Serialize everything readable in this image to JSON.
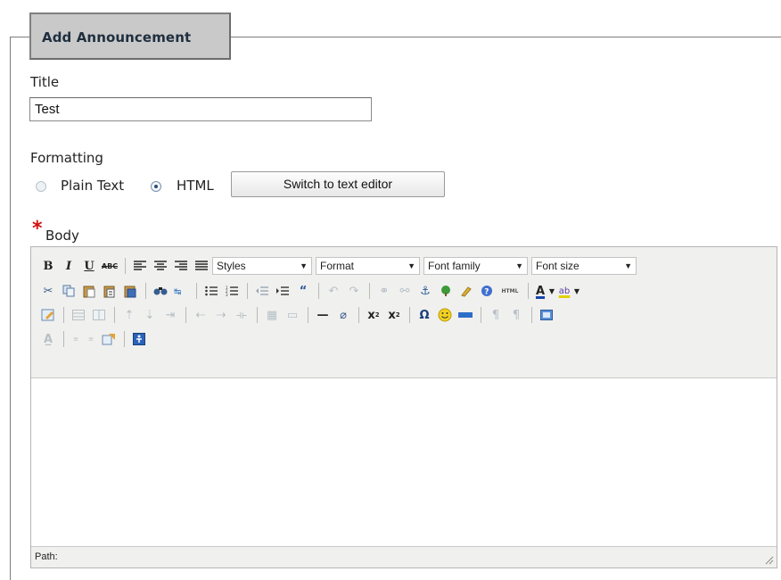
{
  "panel": {
    "legend": "Add Announcement"
  },
  "form": {
    "title_label": "Title",
    "title_value": "Test",
    "formatting_label": "Formatting",
    "radio_plain": "Plain Text",
    "radio_html": "HTML",
    "selected_format": "HTML",
    "switch_button": "Switch to text editor",
    "body_required_mark": "*",
    "body_label": "Body"
  },
  "editor": {
    "toolbar_row1": {
      "bold": "B",
      "italic": "I",
      "underline": "U",
      "strike": "ABC",
      "styles": "Styles",
      "format": "Format",
      "font_family": "Font family",
      "font_size": "Font size"
    },
    "toolbar_icons_row2": [
      "cut-icon",
      "copy-icon",
      "paste-icon",
      "paste-text-icon",
      "paste-word-icon",
      "find-icon",
      "replace-icon",
      "bullet-list-icon",
      "numbered-list-icon",
      "outdent-icon",
      "indent-icon",
      "blockquote-icon",
      "undo-icon",
      "redo-icon",
      "link-icon",
      "unlink-icon",
      "anchor-icon",
      "image-icon",
      "cleanup-icon",
      "help-icon",
      "html-source-icon",
      "text-color-icon",
      "highlight-color-icon"
    ],
    "html_icon_text": "HTML",
    "status_path_label": "Path:"
  }
}
